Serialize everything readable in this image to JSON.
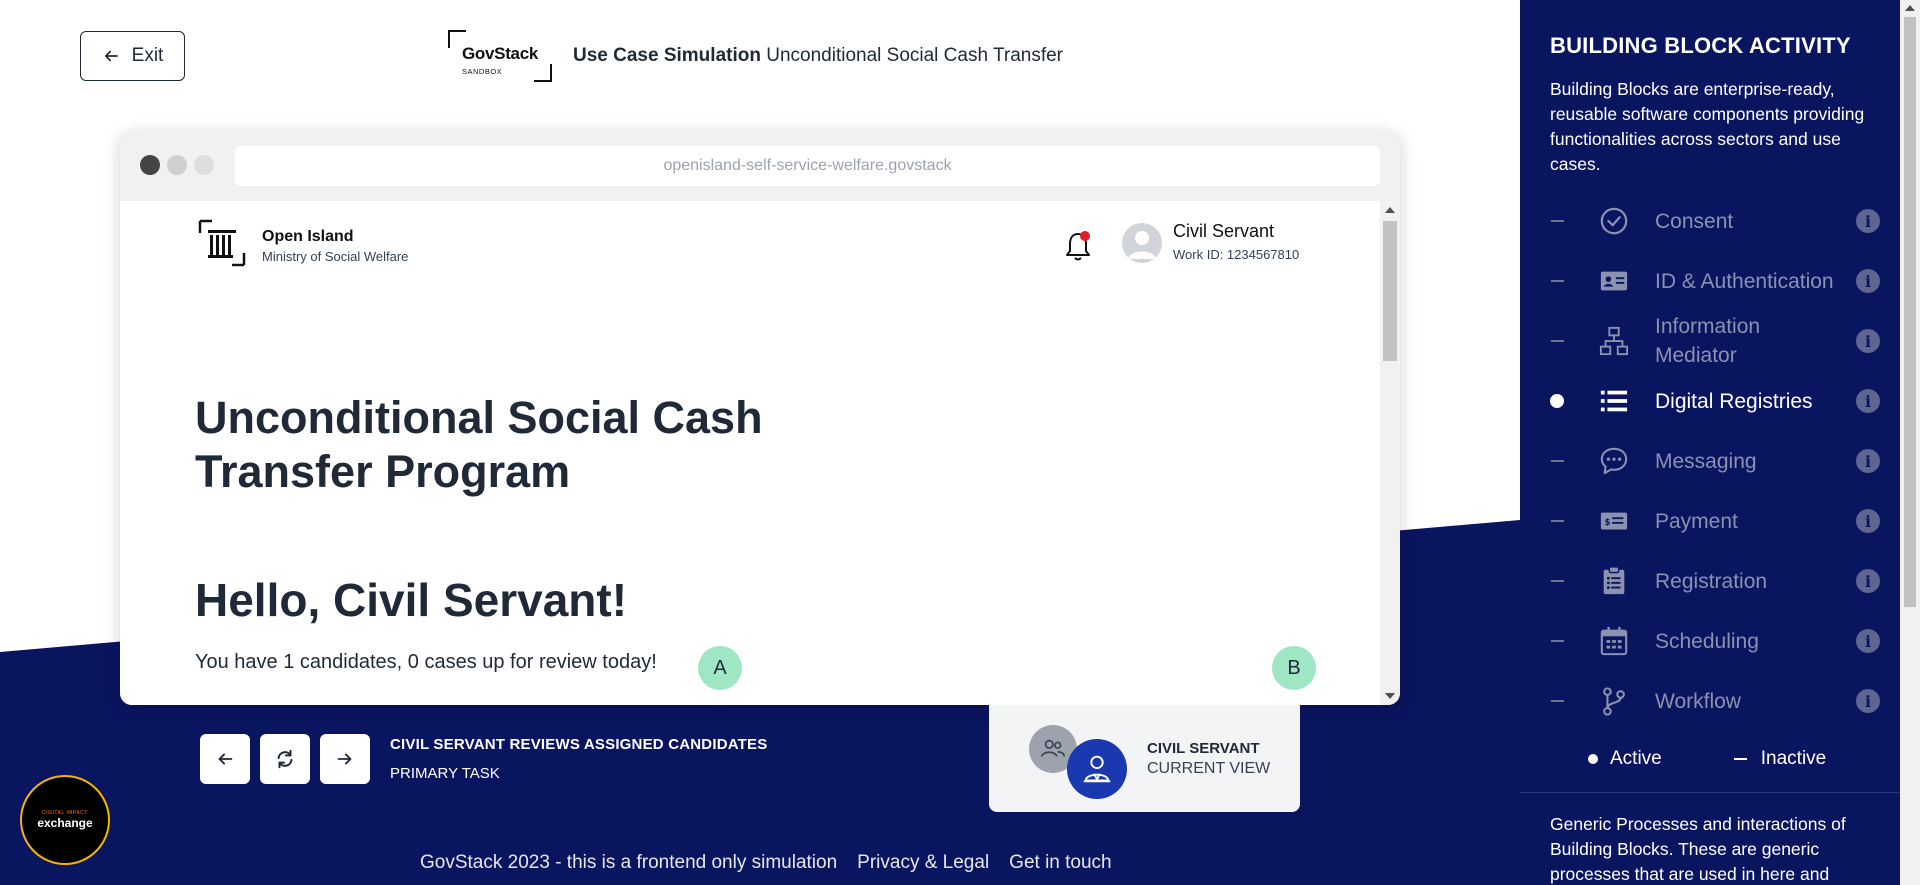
{
  "header": {
    "exit_label": "Exit",
    "logo_name": "GovStack",
    "logo_sub": "SANDBOX",
    "title_bold": "Use Case Simulation",
    "title_rest": "Unconditional Social Cash Transfer"
  },
  "browser": {
    "url": "openisland-self-service-welfare.govstack"
  },
  "app": {
    "org_name": "Open Island",
    "ministry": "Ministry of Social Welfare",
    "user_name": "Civil Servant",
    "user_id": "Work ID: 1234567810",
    "program_title": "Unconditional Social Cash Transfer Program",
    "greeting": "Hello, Civil Servant!",
    "review_text": "You have 1 candidates, 0 cases up for review today!",
    "marker_a": "A",
    "marker_b": "B"
  },
  "controls": {
    "task_title": "CIVIL SERVANT REVIEWS ASSIGNED CANDIDATES",
    "task_sub": "PRIMARY TASK"
  },
  "view": {
    "title": "CIVIL SERVANT",
    "sub": "CURRENT VIEW"
  },
  "dial_logo": {
    "small": "DIGITAL IMPACT",
    "big": "exchange"
  },
  "footer": {
    "copyright": "GovStack 2023 - this is a frontend only simulation",
    "privacy": "Privacy & Legal",
    "contact": "Get in touch"
  },
  "panel": {
    "title": "BUILDING BLOCK ACTIVITY",
    "description": "Building Blocks are enterprise-ready, reusable software components providing functionalities across sectors and use cases.",
    "items": [
      {
        "label": "Consent",
        "state": "inactive",
        "icon": "check-circle-icon"
      },
      {
        "label": "ID & Authentication",
        "state": "inactive",
        "icon": "id-card-icon"
      },
      {
        "label": "Information Mediator",
        "state": "inactive",
        "icon": "network-icon"
      },
      {
        "label": "Digital Registries",
        "state": "active",
        "icon": "list-icon"
      },
      {
        "label": "Messaging",
        "state": "inactive",
        "icon": "chat-icon"
      },
      {
        "label": "Payment",
        "state": "inactive",
        "icon": "payment-card-icon"
      },
      {
        "label": "Registration",
        "state": "inactive",
        "icon": "clipboard-icon"
      },
      {
        "label": "Scheduling",
        "state": "inactive",
        "icon": "calendar-icon"
      },
      {
        "label": "Workflow",
        "state": "inactive",
        "icon": "branch-icon"
      }
    ],
    "legend_active": "Active",
    "legend_inactive": "Inactive",
    "footer_text": "Generic Processes and interactions of Building Blocks. These are generic processes that are used in here and"
  },
  "colors": {
    "navy": "#0a1560",
    "marker": "#9ee6c4",
    "accent_blue": "#1a38b0"
  }
}
